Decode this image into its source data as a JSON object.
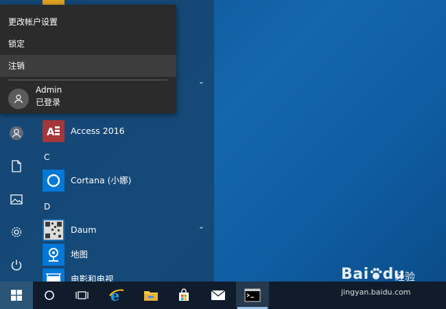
{
  "user_menu": {
    "items": [
      "更改帐户设置",
      "锁定",
      "注销"
    ],
    "highlighted_index": 2,
    "user_name": "Admin",
    "user_status": "已登录"
  },
  "rail": {
    "icons": [
      "user-icon",
      "document-icon",
      "pictures-icon",
      "settings-icon",
      "power-icon"
    ]
  },
  "apps": {
    "items": [
      {
        "name": "Access 2016",
        "icon": "access-icon",
        "tile_color": "#a4373a"
      },
      {
        "name": "Cortana (小娜)",
        "icon": "cortana-icon",
        "tile_color": "#0078d7"
      },
      {
        "name": "Daum",
        "icon": "daum-icon",
        "tile_color": "#1a6fb5"
      },
      {
        "name": "地图",
        "icon": "maps-icon",
        "tile_color": "#0078d7"
      },
      {
        "name": "电影和电视",
        "icon": "movies-tv-icon",
        "tile_color": "#0078d7"
      }
    ],
    "letters": [
      "C",
      "D"
    ]
  },
  "taskbar": {
    "icons": [
      "windows-start-icon",
      "cortana-search-icon",
      "task-view-icon",
      "internet-explorer-icon",
      "file-explorer-icon",
      "microsoft-store-icon",
      "mail-icon",
      "command-prompt-icon"
    ],
    "active": "command-prompt-icon"
  },
  "watermark": {
    "brand": "Bai",
    "brand_tail": "du",
    "product": "经验",
    "url": "jingyan.baidu.com"
  },
  "colors": {
    "desktop": "#1467ad",
    "menu_popup": "#2b2b2b",
    "taskbar": "#101c2b",
    "access_tile": "#a4373a",
    "accent": "#0078d7"
  }
}
